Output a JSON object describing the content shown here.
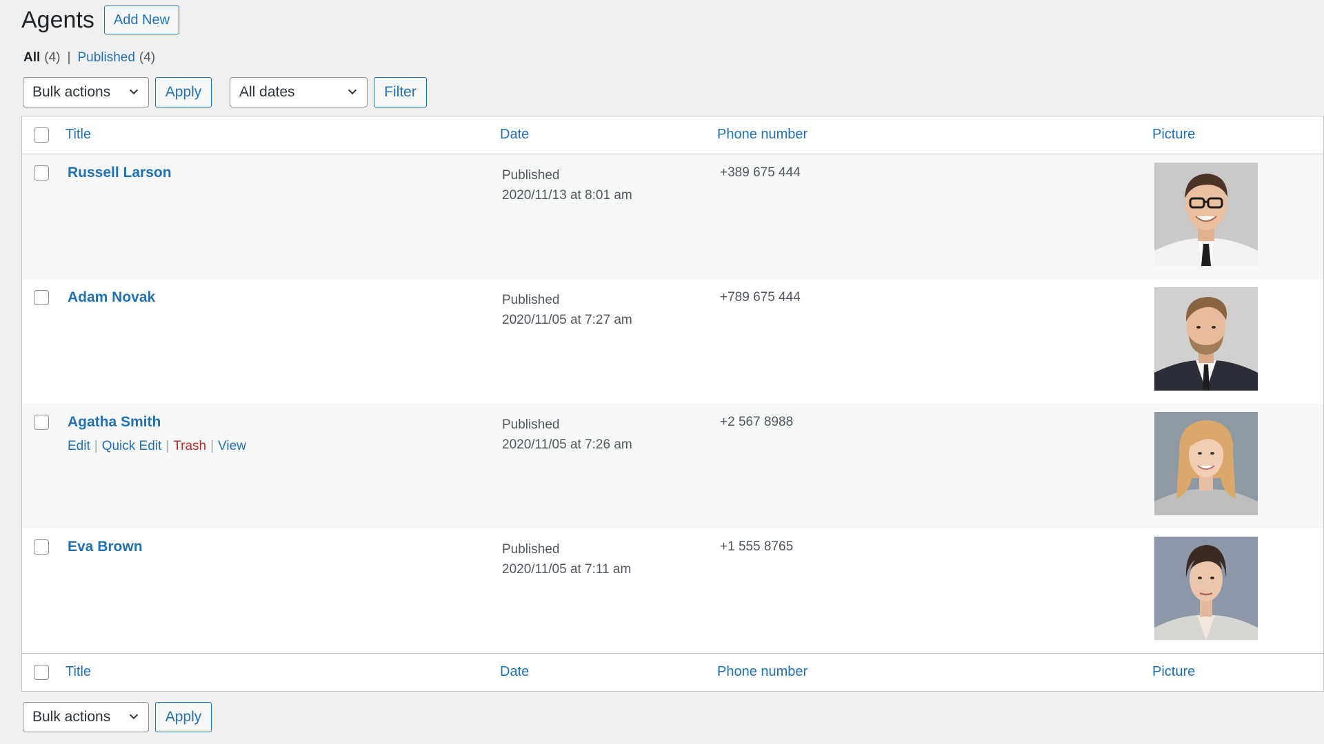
{
  "header": {
    "title": "Agents",
    "add_new": "Add New"
  },
  "views": {
    "all_label": "All",
    "all_count": "(4)",
    "separator": "|",
    "published_label": "Published",
    "published_count": "(4)"
  },
  "top_nav": {
    "bulk_actions": "Bulk actions",
    "apply": "Apply",
    "dates": "All dates",
    "filter": "Filter"
  },
  "bottom_nav": {
    "bulk_actions": "Bulk actions",
    "apply": "Apply"
  },
  "columns": {
    "title": "Title",
    "date": "Date",
    "phone": "Phone number",
    "picture": "Picture"
  },
  "rows": [
    {
      "title": "Russell Larson",
      "status": "Published",
      "date": "2020/11/13 at 8:01 am",
      "phone": "+389 675 444",
      "avatar": "man-glasses-photo"
    },
    {
      "title": "Adam Novak",
      "status": "Published",
      "date": "2020/11/05 at 7:27 am",
      "phone": "+789 675 444",
      "avatar": "man-beard-photo"
    },
    {
      "title": "Agatha Smith",
      "status": "Published",
      "date": "2020/11/05 at 7:26 am",
      "phone": "+2 567 8988",
      "avatar": "woman-blonde-photo",
      "actions": {
        "edit": "Edit",
        "quick_edit": "Quick Edit",
        "trash": "Trash",
        "view": "View",
        "pipe": "|"
      }
    },
    {
      "title": "Eva Brown",
      "status": "Published",
      "date": "2020/11/05 at 7:11 am",
      "phone": "+1 555 8765",
      "avatar": "woman-dark-hair-photo"
    }
  ],
  "colors": {
    "link": "#2271b1",
    "trash": "#b32d2e",
    "background": "#f0f0f1"
  }
}
